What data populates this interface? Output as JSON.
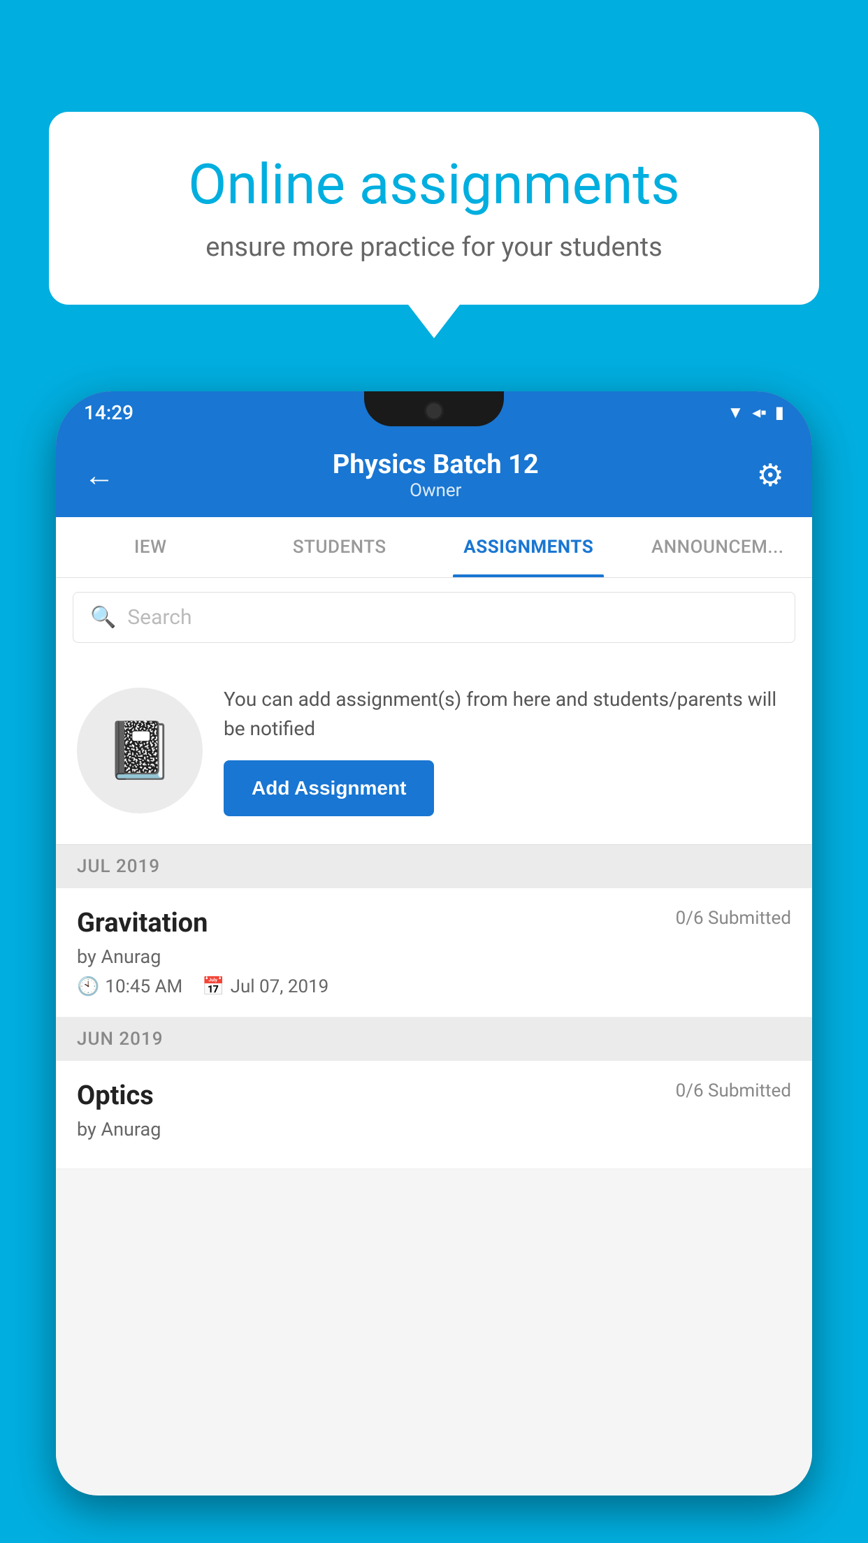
{
  "background": {
    "color": "#00AEDF"
  },
  "speech_bubble": {
    "title": "Online assignments",
    "subtitle": "ensure more practice for your students"
  },
  "status_bar": {
    "time": "14:29",
    "icons": [
      "wifi",
      "signal",
      "battery"
    ]
  },
  "header": {
    "title": "Physics Batch 12",
    "subtitle": "Owner",
    "back_label": "←",
    "settings_label": "⚙"
  },
  "tabs": [
    {
      "label": "IEW",
      "active": false
    },
    {
      "label": "STUDENTS",
      "active": false
    },
    {
      "label": "ASSIGNMENTS",
      "active": true
    },
    {
      "label": "ANNOUNCEM...",
      "active": false
    }
  ],
  "search": {
    "placeholder": "Search"
  },
  "add_assignment_card": {
    "description": "You can add assignment(s) from here and students/parents will be notified",
    "button_label": "Add Assignment"
  },
  "sections": [
    {
      "header": "JUL 2019",
      "assignments": [
        {
          "title": "Gravitation",
          "submitted": "0/6 Submitted",
          "author": "by Anurag",
          "time": "10:45 AM",
          "date": "Jul 07, 2019"
        }
      ]
    },
    {
      "header": "JUN 2019",
      "assignments": [
        {
          "title": "Optics",
          "submitted": "0/6 Submitted",
          "author": "by Anurag",
          "time": "",
          "date": ""
        }
      ]
    }
  ]
}
